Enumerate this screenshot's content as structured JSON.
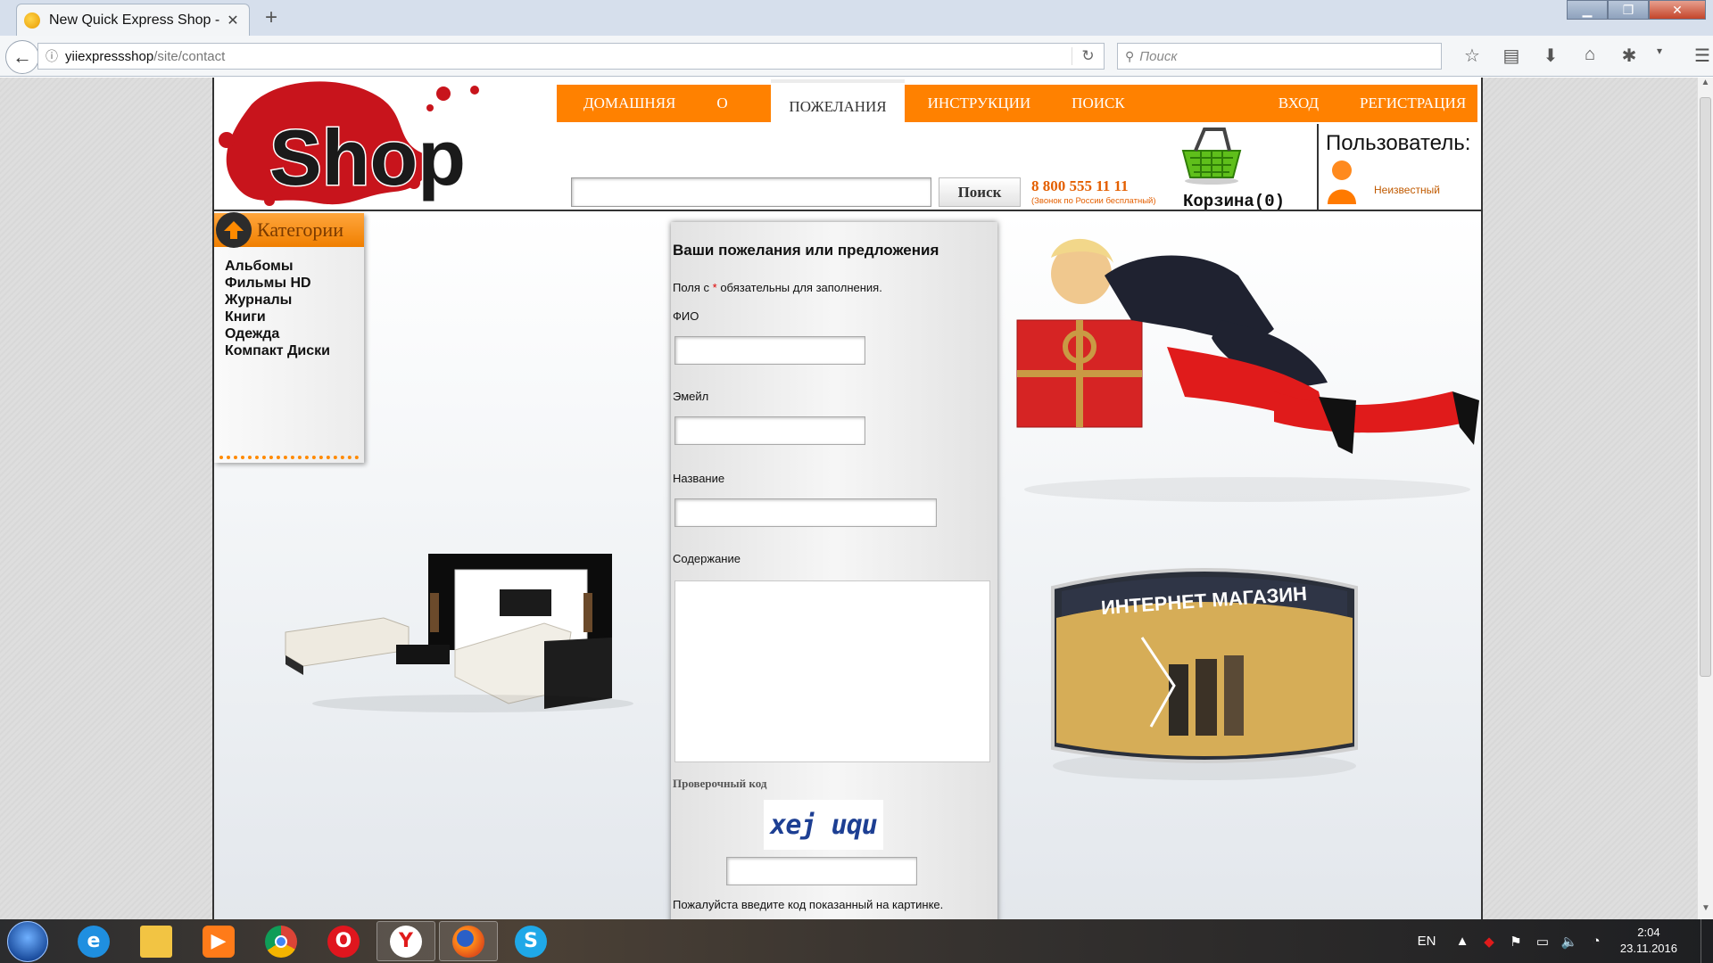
{
  "browser": {
    "tab_title": "New Quick Express Shop - ...",
    "url_host": "yiiexpressshop",
    "url_path": "/site/contact",
    "search_placeholder": "Поиск"
  },
  "site": {
    "logo_text": "Shop",
    "menu": [
      {
        "label": "Домашняя",
        "active": false
      },
      {
        "label": "О нас",
        "active": false
      },
      {
        "label": "Пожелания",
        "active": true
      },
      {
        "label": "Инструкции",
        "active": false
      },
      {
        "label": "Поиск",
        "active": false
      },
      {
        "label": "Вход",
        "active": false
      },
      {
        "label": "Регистрация",
        "active": false
      }
    ],
    "search_button": "Поиск",
    "phone": "8 800 555 11 11",
    "phone_note": "(Звонок по России бесплатный)",
    "cart_label": "Корзина(0)",
    "user_title": "Пользователь:",
    "user_name": "Неизвестный",
    "categories_title": "Категории",
    "categories": [
      "Альбомы",
      "Фильмы HD",
      "Журналы",
      "Книги",
      "Одежда",
      "Компакт Диски"
    ],
    "storefront_sign": "ИНТЕРНЕТ МАГАЗИН"
  },
  "form": {
    "title": "Ваши пожелания или предложения",
    "note_prefix": "Поля с ",
    "note_required_mark": "*",
    "note_suffix": " обязательны для заполнения.",
    "fields": {
      "name": "ФИО",
      "email": "Эмейл",
      "subject": "Название",
      "body": "Содержание"
    },
    "captcha_label": "Проверочный код",
    "captcha_code": "xej uqu",
    "captcha_hint": "Пожалуйста введите код показанный на картинке."
  },
  "taskbar": {
    "language": "EN",
    "time": "2:04",
    "date": "23.11.2016"
  },
  "colors": {
    "accent": "#ff8100",
    "required": "#dd0000"
  }
}
